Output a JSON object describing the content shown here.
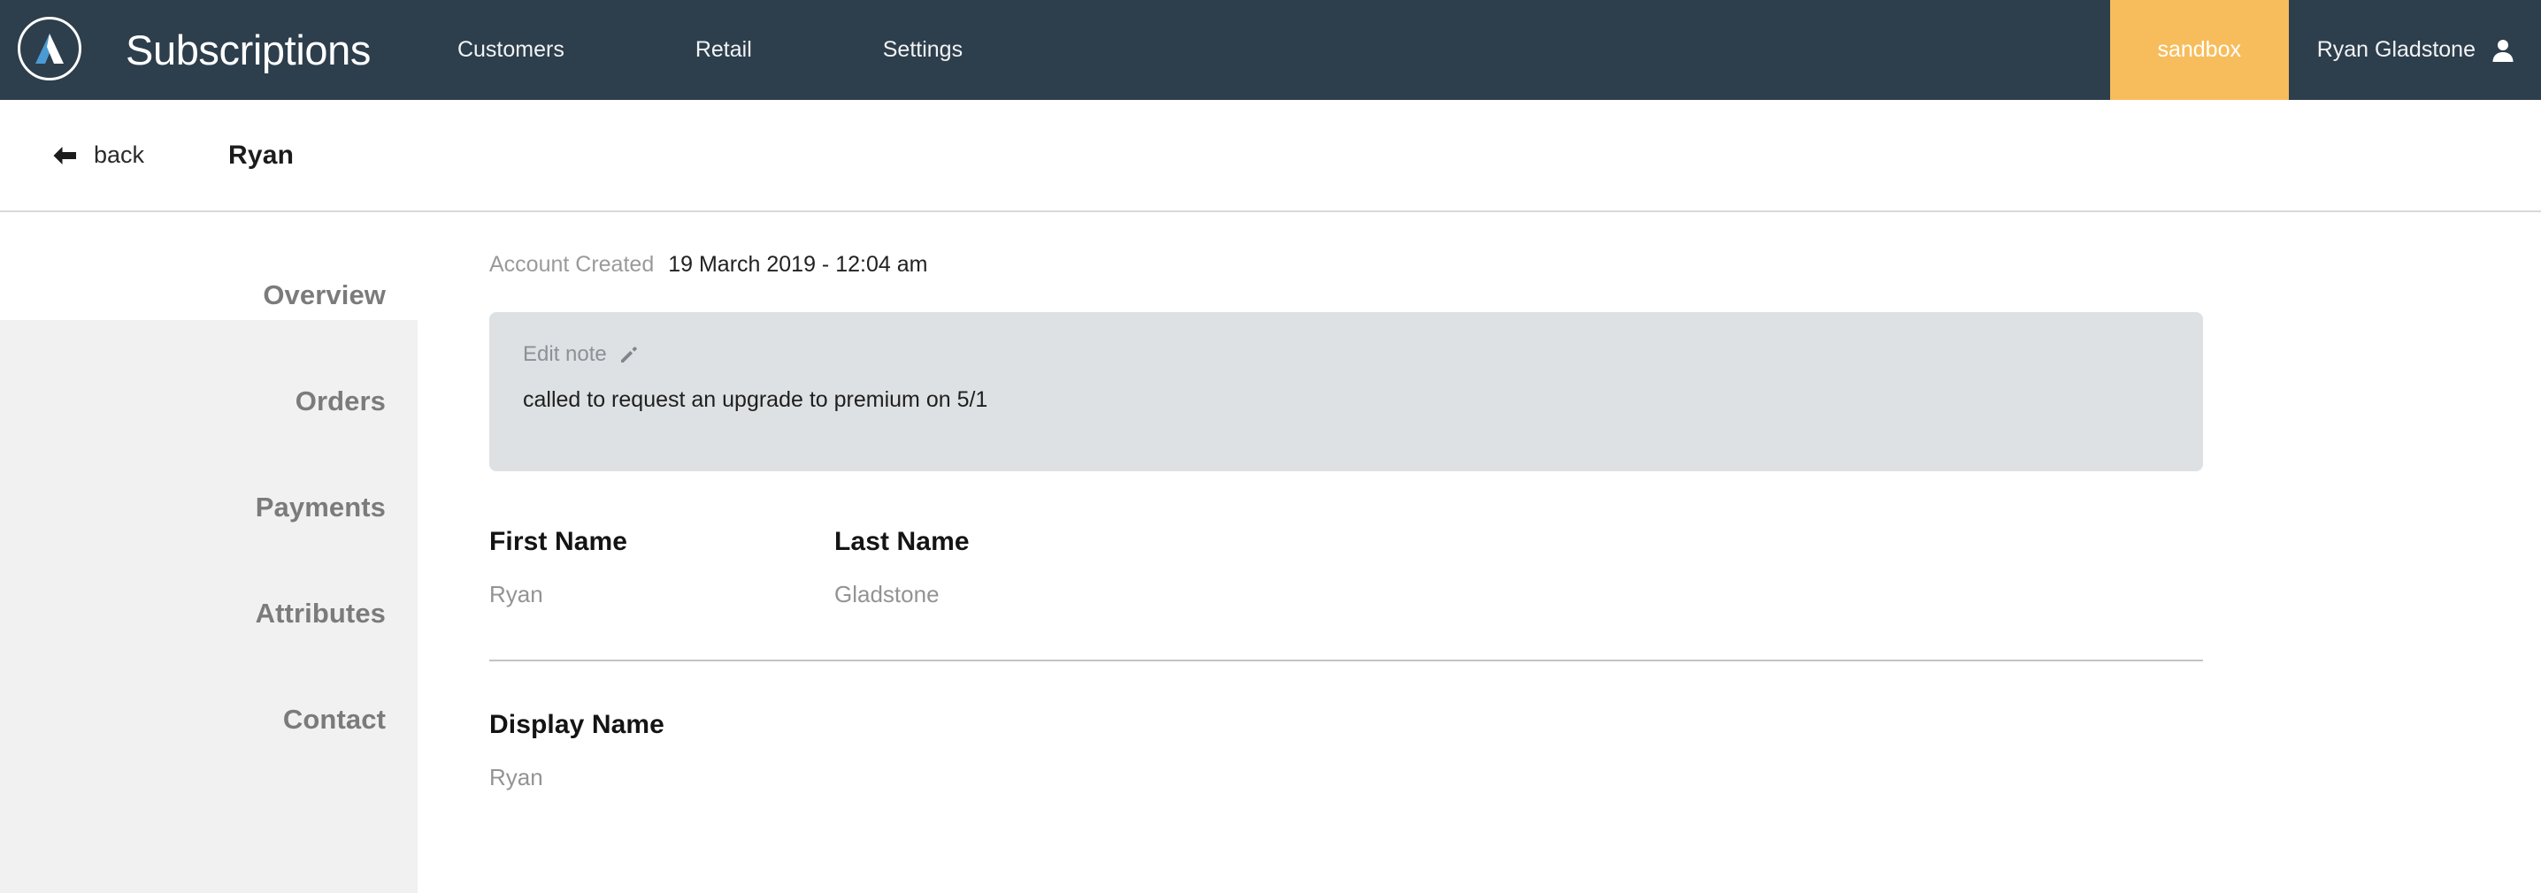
{
  "navbar": {
    "brand_title": "Subscriptions",
    "logo_icon": "triangle-a-logo-icon",
    "links": [
      {
        "label": "Customers",
        "name": "nav-link-customers"
      },
      {
        "label": "Retail",
        "name": "nav-link-retail"
      },
      {
        "label": "Settings",
        "name": "nav-link-settings"
      }
    ],
    "env_badge": "sandbox",
    "user_name": "Ryan Gladstone",
    "user_icon": "user-avatar-icon",
    "colors": {
      "background": "#2d3e4c",
      "env_badge_background": "#f7bd5c",
      "logo_blue": "#4a9bd4"
    }
  },
  "subheader": {
    "back_label": "back",
    "back_icon": "arrow-left-icon",
    "page_title": "Ryan"
  },
  "sidebar": {
    "items": [
      {
        "label": "Overview",
        "name": "sidebar-item-overview",
        "active": true
      },
      {
        "label": "Orders",
        "name": "sidebar-item-orders",
        "active": false
      },
      {
        "label": "Payments",
        "name": "sidebar-item-payments",
        "active": false
      },
      {
        "label": "Attributes",
        "name": "sidebar-item-attributes",
        "active": false
      },
      {
        "label": "Contact",
        "name": "sidebar-item-contact",
        "active": false
      }
    ]
  },
  "main": {
    "account_created": {
      "label": "Account Created",
      "value": "19 March 2019 - 12:04 am"
    },
    "note": {
      "edit_label": "Edit note",
      "edit_icon": "pencil-icon",
      "text": "called to request an upgrade to premium on 5/1",
      "background": "#dee1e3"
    },
    "fields": {
      "first_name": {
        "label": "First Name",
        "value": "Ryan"
      },
      "last_name": {
        "label": "Last Name",
        "value": "Gladstone"
      },
      "display_name": {
        "label": "Display Name",
        "value": "Ryan"
      }
    }
  }
}
